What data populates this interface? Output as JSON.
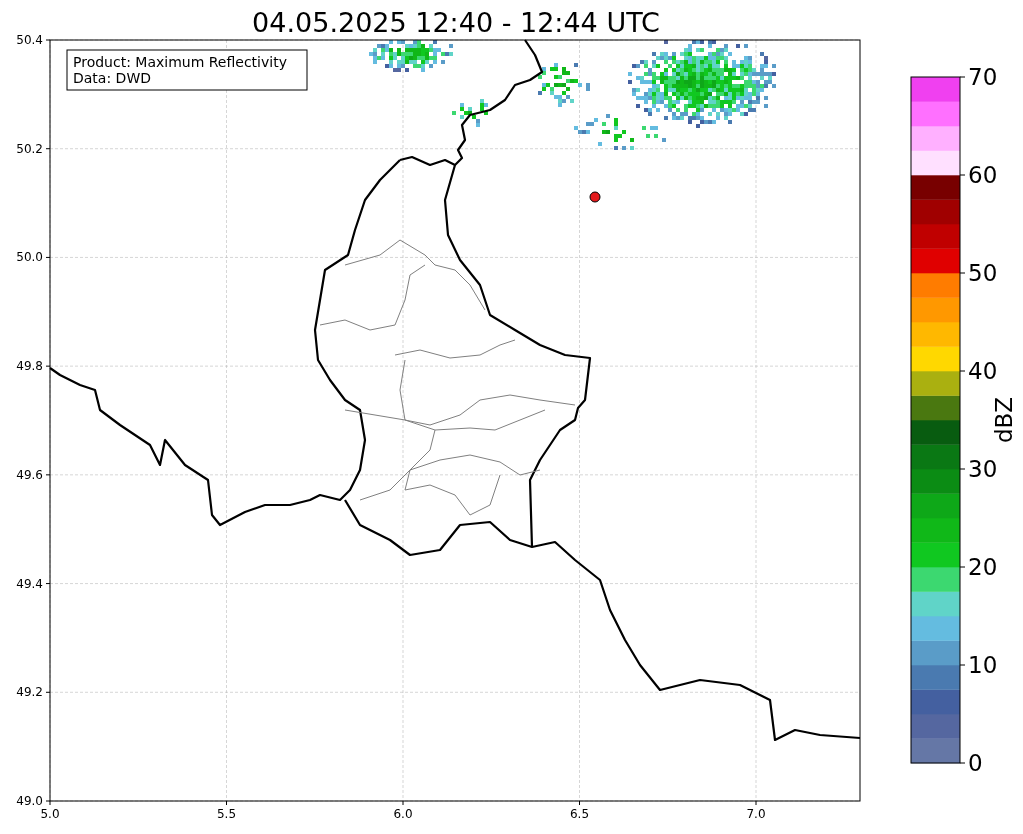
{
  "title": "04.05.2025 12:40 - 12:44 UTC",
  "annotation": {
    "lines": [
      "Product: Maximum Reflectivity",
      "Data: DWD"
    ]
  },
  "map": {
    "xticks": [
      "5.0",
      "5.5",
      "6.0",
      "6.5",
      "7.0"
    ],
    "yticks": [
      "50.4",
      "50.2",
      "50.0",
      "49.8",
      "49.6",
      "49.4",
      "49.2",
      "49.0"
    ]
  },
  "colorbar": {
    "label": "dBZ",
    "ticks": [
      "70",
      "60",
      "50",
      "40",
      "30",
      "20",
      "10",
      "0"
    ],
    "bins": [
      {
        "color": "#6577a6"
      },
      {
        "color": "#5567a0"
      },
      {
        "color": "#4460a0"
      },
      {
        "color": "#4a7ab0"
      },
      {
        "color": "#5a9cc8"
      },
      {
        "color": "#64bce0"
      },
      {
        "color": "#60d4c8"
      },
      {
        "color": "#3cd870"
      },
      {
        "color": "#10c820"
      },
      {
        "color": "#10b818"
      },
      {
        "color": "#0ea818"
      },
      {
        "color": "#0b8c14"
      },
      {
        "color": "#0a7814"
      },
      {
        "color": "#085c10"
      },
      {
        "color": "#4a7810"
      },
      {
        "color": "#aab010"
      },
      {
        "color": "#ffd800"
      },
      {
        "color": "#ffb800"
      },
      {
        "color": "#ff9800"
      },
      {
        "color": "#ff7c00"
      },
      {
        "color": "#e00000"
      },
      {
        "color": "#c00000"
      },
      {
        "color": "#a00000"
      },
      {
        "color": "#780000"
      },
      {
        "color": "#ffe0ff"
      },
      {
        "color": "#ffb0ff"
      },
      {
        "color": "#ff70ff"
      },
      {
        "color": "#f040f0"
      }
    ]
  }
}
